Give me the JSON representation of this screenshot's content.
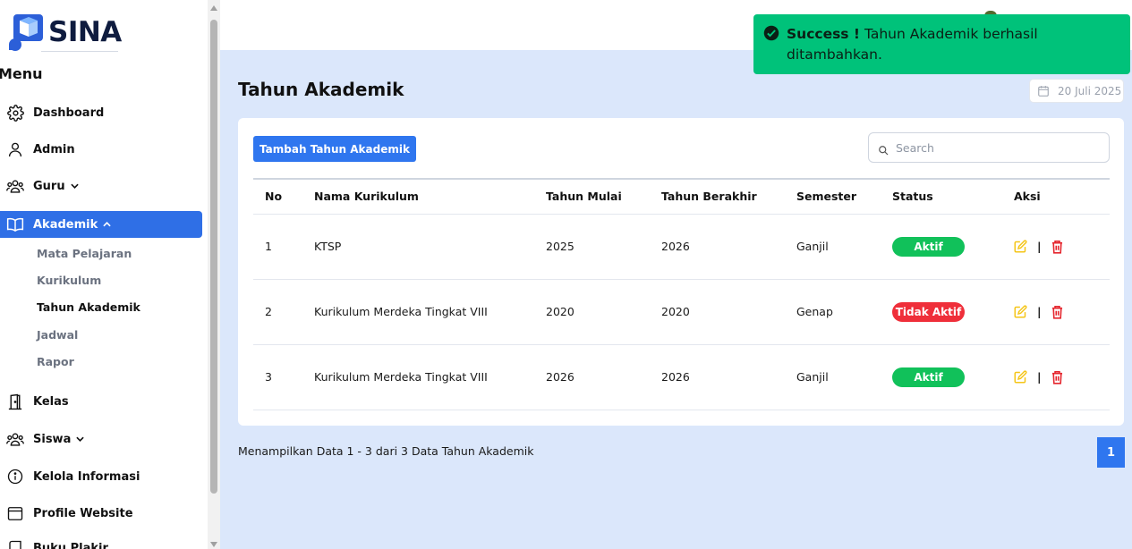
{
  "brand": {
    "name": "SINA"
  },
  "sidebar": {
    "heading": "Menu",
    "items": [
      {
        "label": "Dashboard",
        "icon": "gear-icon"
      },
      {
        "label": "Admin",
        "icon": "user-icon"
      },
      {
        "label": "Guru",
        "icon": "users-icon",
        "expandable": true
      },
      {
        "label": "Akademik",
        "icon": "book-open-icon",
        "expandable": true,
        "active": true
      },
      {
        "label": "Kelas",
        "icon": "door-icon"
      },
      {
        "label": "Siswa",
        "icon": "users-icon",
        "expandable": true
      },
      {
        "label": "Kelola Informasi",
        "icon": "info-icon"
      },
      {
        "label": "Profile Website",
        "icon": "browser-icon"
      },
      {
        "label": "Buku Plakir",
        "icon": "book-icon"
      }
    ],
    "subitems": [
      {
        "label": "Mata Pelajaran"
      },
      {
        "label": "Kurikulum"
      },
      {
        "label": "Tahun Akademik",
        "current": true
      },
      {
        "label": "Jadwal"
      },
      {
        "label": "Rapor"
      }
    ]
  },
  "toast": {
    "title": "Success !",
    "message": "Tahun Akademik berhasil ditambahkan.",
    "color": "#00c27a"
  },
  "page": {
    "title": "Tahun Akademik",
    "date": "20 Juli 2025"
  },
  "toolbar": {
    "add_label": "Tambah Tahun Akademik",
    "search_placeholder": "Search"
  },
  "table": {
    "columns": [
      "No",
      "Nama Kurikulum",
      "Tahun Mulai",
      "Tahun Berakhir",
      "Semester",
      "Status",
      "Aksi"
    ],
    "rows": [
      {
        "no": "1",
        "nama": "KTSP",
        "mulai": "2025",
        "berakhir": "2026",
        "semester": "Ganjil",
        "status": "Aktif"
      },
      {
        "no": "2",
        "nama": "Kurikulum Merdeka Tingkat VIII",
        "mulai": "2020",
        "berakhir": "2020",
        "semester": "Genap",
        "status": "Tidak Aktif"
      },
      {
        "no": "3",
        "nama": "Kurikulum Merdeka Tingkat VIII",
        "mulai": "2026",
        "berakhir": "2026",
        "semester": "Ganjil",
        "status": "Aktif"
      }
    ],
    "action_separator": "|"
  },
  "footer": {
    "info": "Menampilkan Data 1 - 3 dari 3 Data Tahun Akademik",
    "page": "1"
  },
  "colors": {
    "primary": "#2f76ef",
    "active_badge": "#11c15a",
    "inactive_badge": "#ef2f3a",
    "edit_icon": "#f5c518",
    "delete_icon": "#e5262e",
    "background": "#dbe7fb"
  }
}
